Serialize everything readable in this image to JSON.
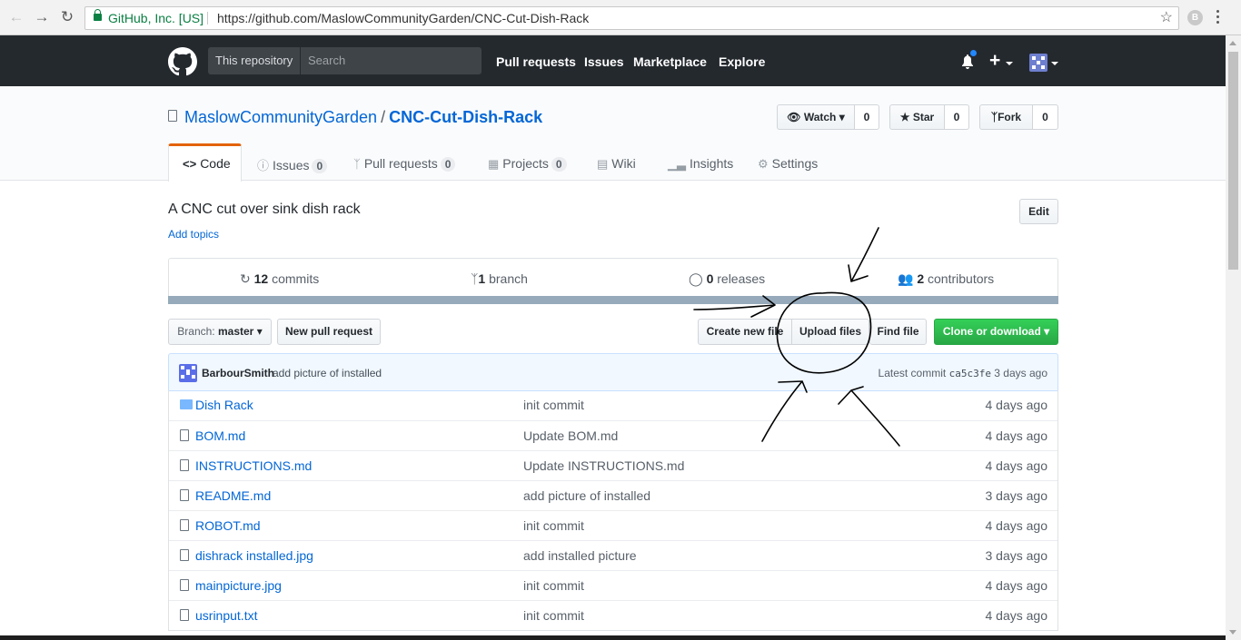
{
  "browser": {
    "secure_label": "GitHub, Inc. [US]",
    "url": "https://github.com/MaslowCommunityGarden/CNC-Cut-Dish-Rack",
    "profile_initial": "B"
  },
  "header": {
    "scope_label": "This repository",
    "search_placeholder": "Search",
    "nav": [
      "Pull requests",
      "Issues",
      "Marketplace",
      "Explore"
    ]
  },
  "repo": {
    "owner": "MaslowCommunityGarden",
    "separator": "/",
    "name": "CNC-Cut-Dish-Rack",
    "watch_label": "Watch",
    "watch_count": "0",
    "star_label": "Star",
    "star_count": "0",
    "fork_label": "Fork",
    "fork_count": "0"
  },
  "tabs": [
    {
      "label": "Code",
      "icon": "code-icon"
    },
    {
      "label": "Issues",
      "count": "0",
      "icon": "issue-icon"
    },
    {
      "label": "Pull requests",
      "count": "0",
      "icon": "pull-request-icon"
    },
    {
      "label": "Projects",
      "count": "0",
      "icon": "project-icon"
    },
    {
      "label": "Wiki",
      "icon": "book-icon"
    },
    {
      "label": "Insights",
      "icon": "graph-icon"
    },
    {
      "label": "Settings",
      "icon": "gear-icon"
    }
  ],
  "description": "A CNC cut over sink dish rack",
  "add_topics": "Add topics",
  "edit_label": "Edit",
  "summary": {
    "commits_num": "12",
    "commits_label": "commits",
    "branch_num": "1",
    "branch_label": "branch",
    "releases_num": "0",
    "releases_label": "releases",
    "contributors_num": "2",
    "contributors_label": "contributors"
  },
  "language_bar_color": "#96aabb",
  "filenav": {
    "branch_prefix": "Branch:",
    "branch_name": "master",
    "new_pr": "New pull request",
    "create_file": "Create new file",
    "upload": "Upload files",
    "find": "Find file",
    "clone": "Clone or download"
  },
  "latest_commit": {
    "author": "BarbourSmith",
    "message": "add picture of installed",
    "prefix": "Latest commit",
    "sha": "ca5c3fe",
    "age": "3 days ago"
  },
  "files": [
    {
      "type": "dir",
      "name": "Dish Rack",
      "message": "init commit",
      "age": "4 days ago"
    },
    {
      "type": "file",
      "name": "BOM.md",
      "message": "Update BOM.md",
      "age": "4 days ago"
    },
    {
      "type": "file",
      "name": "INSTRUCTIONS.md",
      "message": "Update INSTRUCTIONS.md",
      "age": "4 days ago"
    },
    {
      "type": "file",
      "name": "README.md",
      "message": "add picture of installed",
      "age": "3 days ago"
    },
    {
      "type": "file",
      "name": "ROBOT.md",
      "message": "init commit",
      "age": "4 days ago"
    },
    {
      "type": "file",
      "name": "dishrack installed.jpg",
      "message": "add installed picture",
      "age": "3 days ago"
    },
    {
      "type": "file",
      "name": "mainpicture.jpg",
      "message": "init commit",
      "age": "4 days ago"
    },
    {
      "type": "file",
      "name": "usrinput.txt",
      "message": "init commit",
      "age": "4 days ago"
    }
  ],
  "colors": {
    "header_bg": "#24292e",
    "link": "#0366d6",
    "tab_accent": "#e36209",
    "clone_button": "#28a745",
    "annotation_ink": "#000000"
  }
}
